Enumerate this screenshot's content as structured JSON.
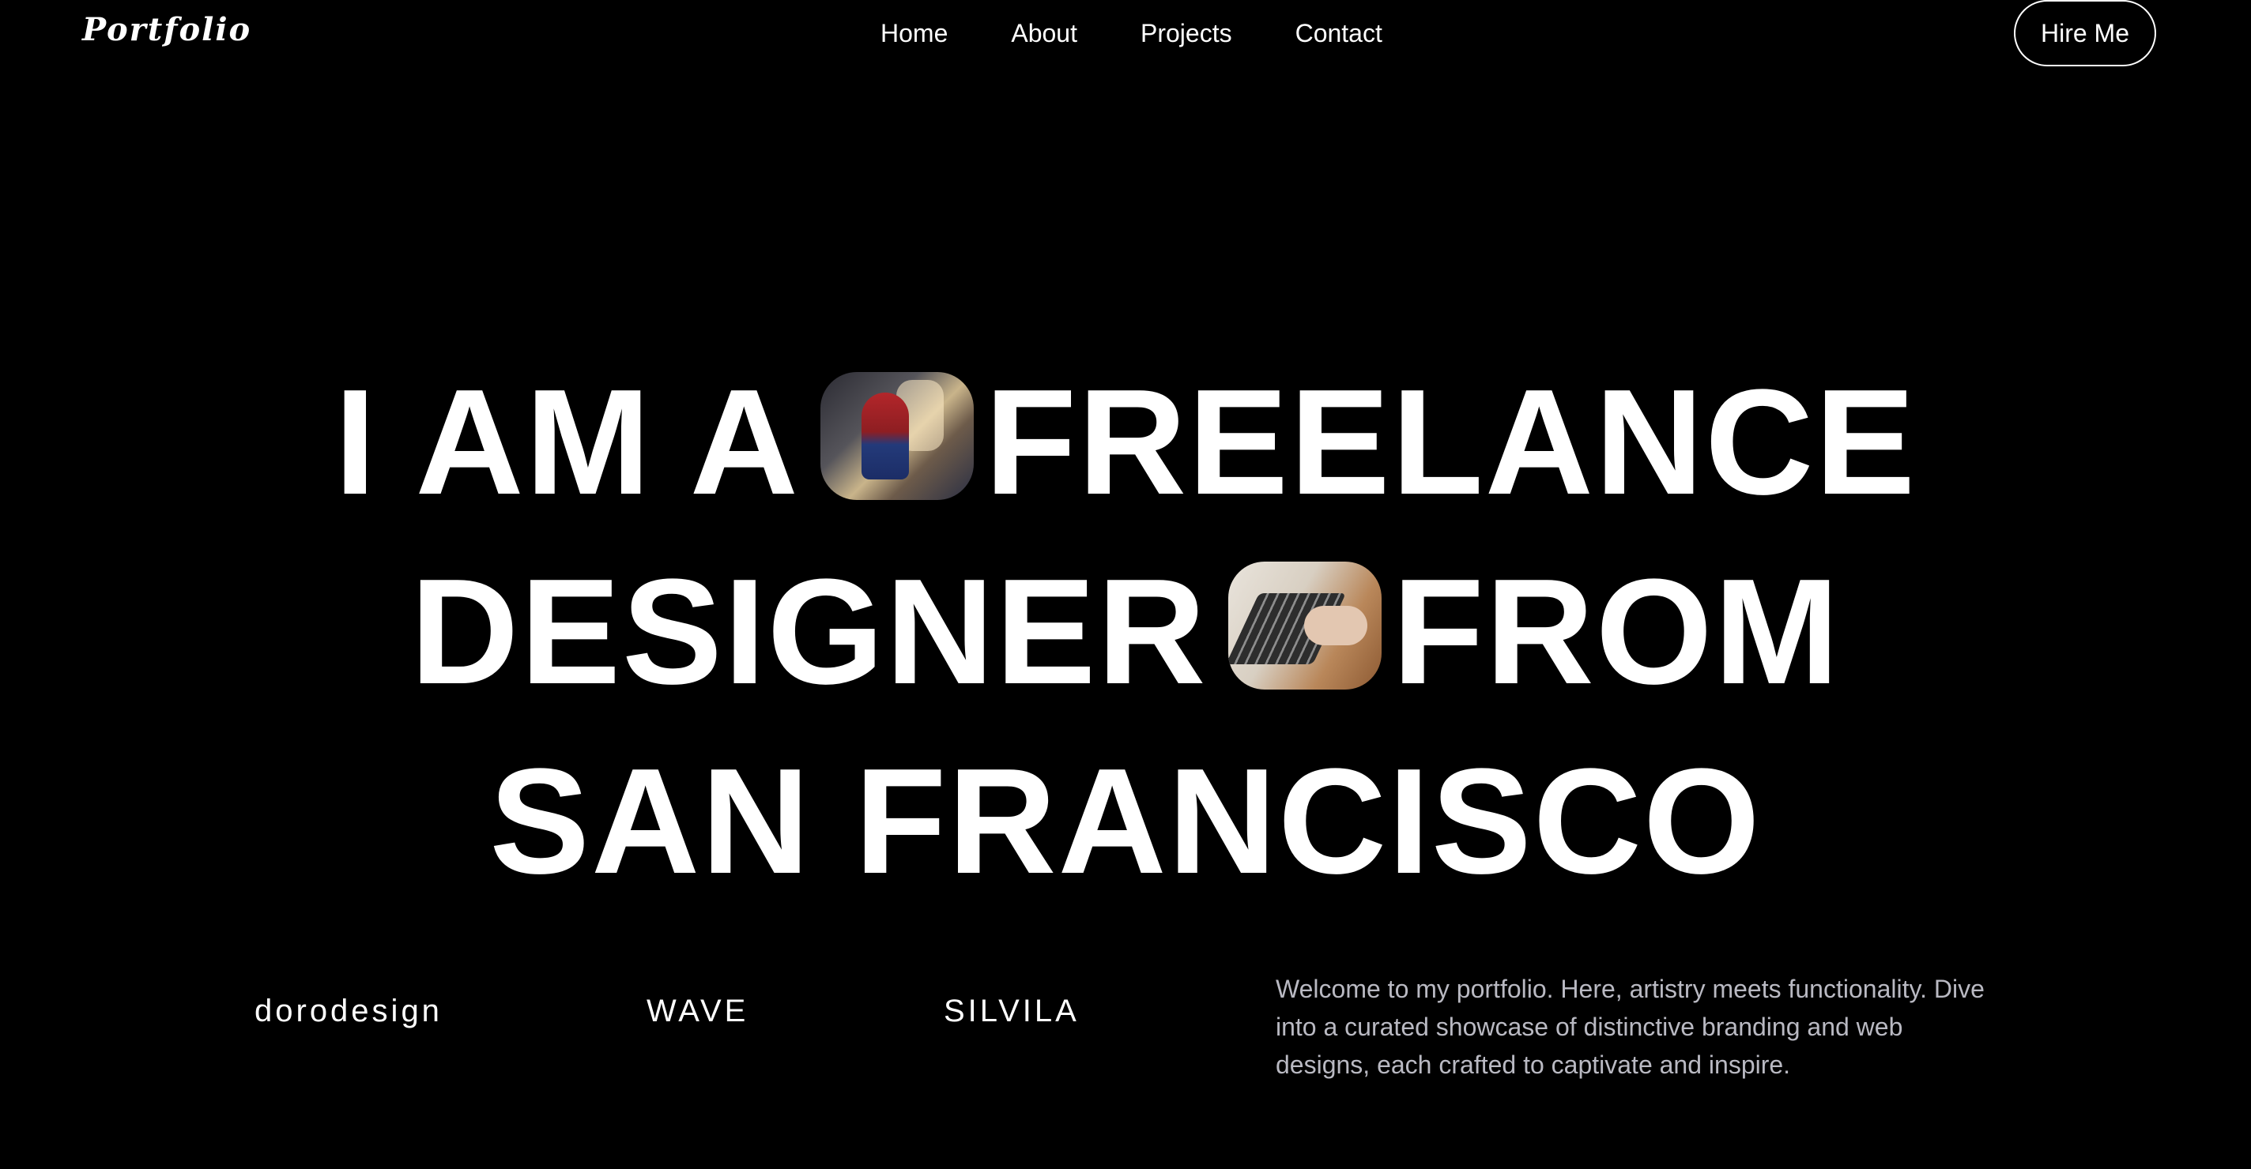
{
  "header": {
    "logo": "Portfolio",
    "nav": [
      "Home",
      "About",
      "Projects",
      "Contact"
    ],
    "cta": "Hire Me"
  },
  "hero": {
    "line1_a": "I AM A",
    "line1_b": "FREELANCE",
    "line2_a": "DESIGNER",
    "line2_b": "FROM",
    "line3": "SAN FRANCISCO",
    "images": [
      "spiderman-photo",
      "laptop-photo"
    ]
  },
  "brands": [
    "dorodesign",
    "WAVE",
    "SILVILA"
  ],
  "intro": "Welcome to my portfolio. Here, artistry meets functionality. Dive into a curated showcase of distinctive branding and web designs, each crafted to captivate and inspire.",
  "colors": {
    "background": "#000000",
    "text": "#ffffff",
    "muted_text": "#b9b9c2"
  }
}
